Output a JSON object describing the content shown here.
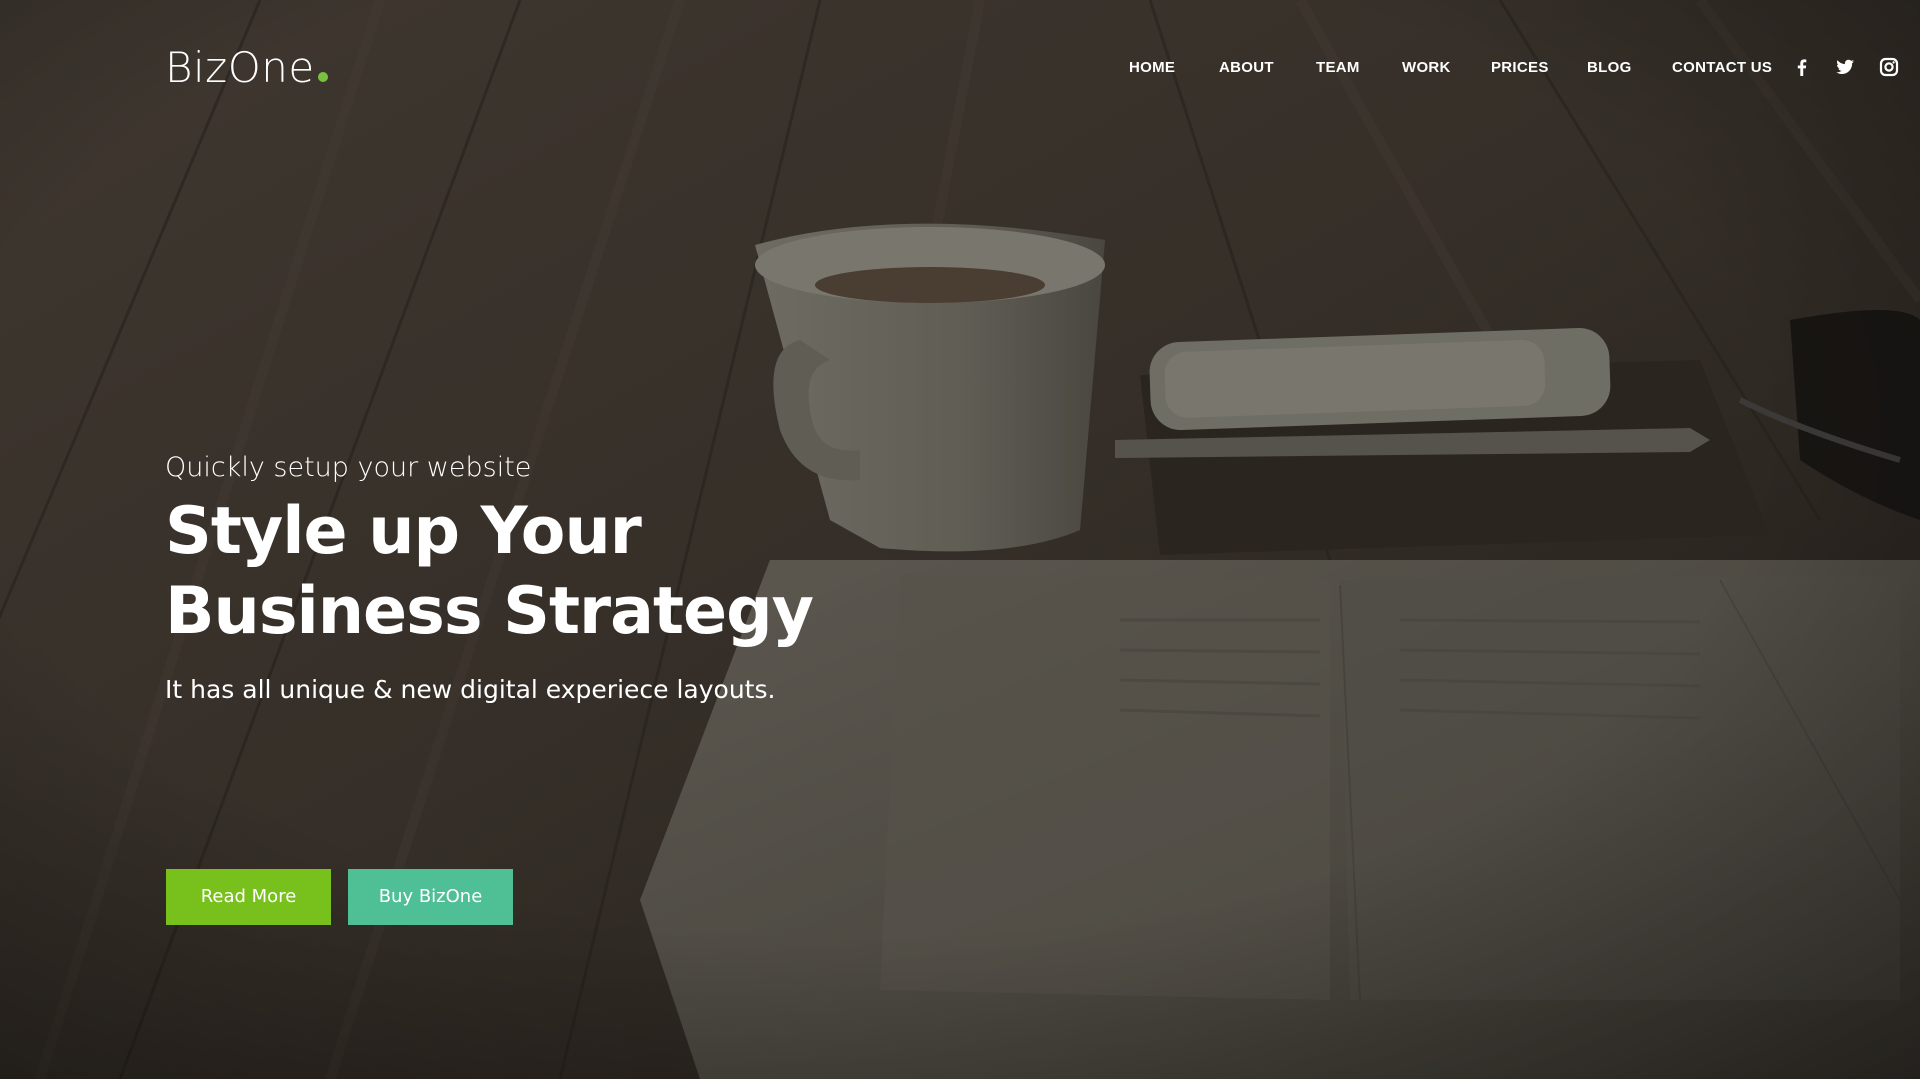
{
  "brand": {
    "name": "BizOne",
    "dot_color": "#7ac142"
  },
  "nav": {
    "items": [
      {
        "label": "HOME"
      },
      {
        "label": "ABOUT"
      },
      {
        "label": "TEAM"
      },
      {
        "label": "WORK"
      },
      {
        "label": "PRICES"
      },
      {
        "label": "BLOG"
      },
      {
        "label": "CONTACT US"
      }
    ],
    "social": [
      "facebook-icon",
      "twitter-icon",
      "instagram-icon"
    ]
  },
  "hero": {
    "pretitle": "Quickly setup your website",
    "title_line1": "Style up Your",
    "title_line2": "Business Strategy",
    "subtitle": "It has all unique & new digital experiece layouts.",
    "primary_button": "Read More",
    "secondary_button": "Buy BizOne"
  },
  "colors": {
    "primary_button": "#78c11d",
    "secondary_button": "#4fbf95",
    "text": "#ffffff"
  }
}
